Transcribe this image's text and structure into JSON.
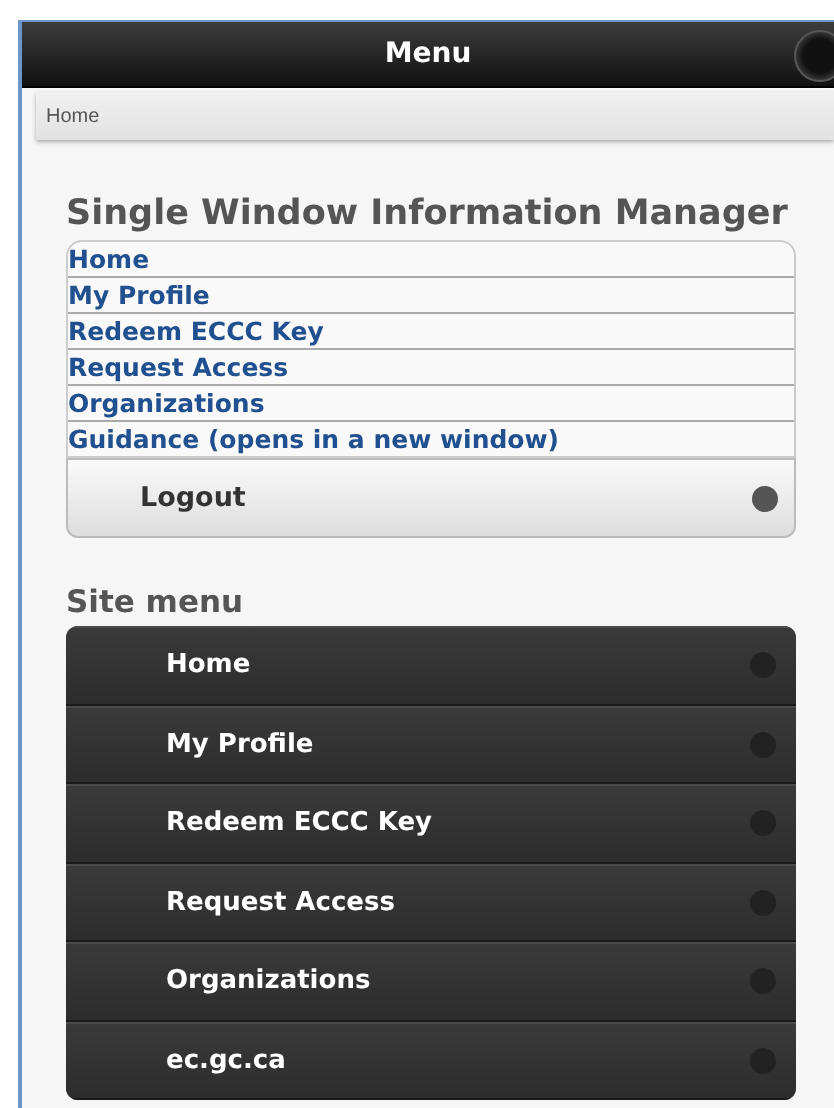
{
  "header": {
    "title": "Menu"
  },
  "breadcrumb": "Home",
  "section": {
    "title": "Single Window Information Manager",
    "links": [
      "Home",
      "My Profile",
      "Redeem ECCC Key",
      "Request Access",
      "Organizations",
      "Guidance (opens in a new window)"
    ],
    "button": "Logout"
  },
  "site_menu": {
    "title": "Site menu",
    "items": [
      "Home",
      "My Profile",
      "Redeem ECCC Key",
      "Request Access",
      "Organizations",
      "ec.gc.ca"
    ]
  }
}
